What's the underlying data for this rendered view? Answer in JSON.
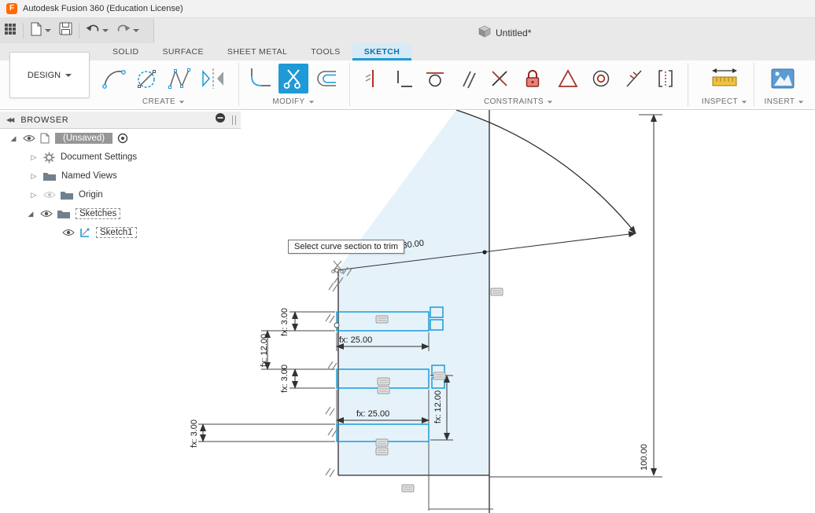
{
  "title_bar": {
    "app_title": "Autodesk Fusion 360 (Education License)"
  },
  "document": {
    "tab_label": "Untitled*"
  },
  "ribbon": {
    "design_label": "DESIGN",
    "tabs": [
      {
        "label": "SOLID",
        "active": false
      },
      {
        "label": "SURFACE",
        "active": false
      },
      {
        "label": "SHEET METAL",
        "active": false
      },
      {
        "label": "TOOLS",
        "active": false
      },
      {
        "label": "SKETCH",
        "active": true
      }
    ],
    "groups": [
      {
        "label": "CREATE"
      },
      {
        "label": "MODIFY"
      },
      {
        "label": "CONSTRAINTS"
      },
      {
        "label": "INSPECT"
      },
      {
        "label": "INSERT"
      }
    ]
  },
  "browser": {
    "header_label": "BROWSER",
    "items": [
      {
        "label": "(Unsaved)"
      },
      {
        "label": "Document Settings"
      },
      {
        "label": "Named Views"
      },
      {
        "label": "Origin"
      },
      {
        "label": "Sketches"
      },
      {
        "label": "Sketch1"
      }
    ]
  },
  "canvas": {
    "tooltip": "Select curve section to trim",
    "dimensions": {
      "d80": "80.00",
      "d100": "100.00",
      "slot1_w": "fx: 25.00",
      "slot2_w": "fx: 25.00",
      "slot1_h": "fx: 3.00",
      "slot2_h": "fx: 3.00",
      "slot3_h": "fx: 3.00",
      "gap1": "fx: 12.00",
      "gap2": "fx: 12.00"
    },
    "colors": {
      "sketch_line": "#1a9bd7",
      "profile_fill": "#cfe7f5",
      "dimension_line": "#333333",
      "accent_blue": "#0696d7"
    }
  }
}
